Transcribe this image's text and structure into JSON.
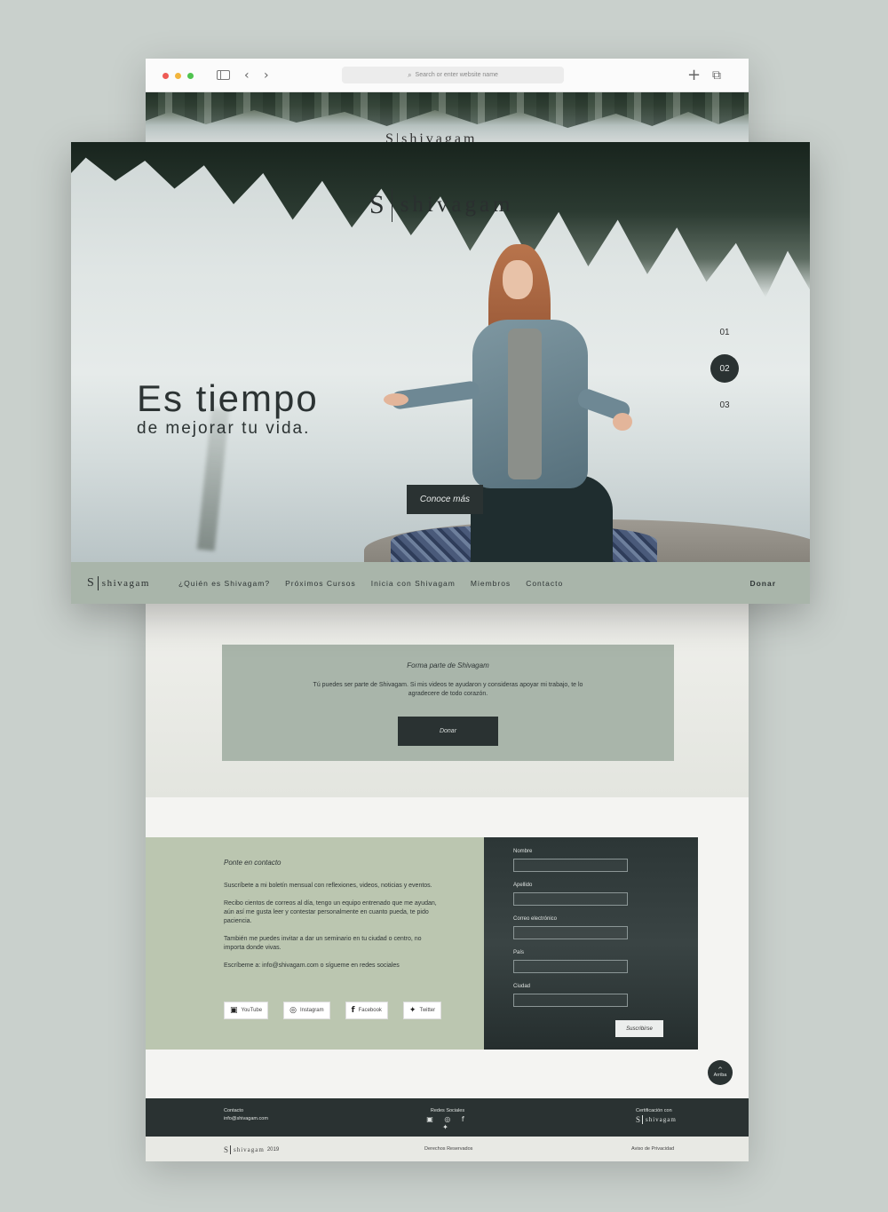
{
  "browser": {
    "url_placeholder": "Search or enter website name",
    "back_icon": "‹",
    "forward_icon": "›",
    "new_tab_icon": "+",
    "tabs_icon": "⧉"
  },
  "brand": {
    "initial": "S",
    "name": "shivagam"
  },
  "hero": {
    "title": "Es tiempo",
    "subtitle": "de mejorar tu vida.",
    "cta": "Conoce más",
    "slides": [
      "01",
      "02",
      "03"
    ],
    "active_slide": 1
  },
  "nav": {
    "items": [
      "¿Quién es Shivagam?",
      "Próximos Cursos",
      "Inicia con Shivagam",
      "Miembros",
      "Contacto"
    ],
    "donate": "Donar"
  },
  "support": {
    "title": "Forma parte de Shivagam",
    "description": "Tú puedes ser parte de Shivagam. Si mis videos te ayudaron y consideras apoyar mi trabajo, te lo agradecere de todo corazón.",
    "button": "Donar"
  },
  "contact": {
    "title": "Ponte en contacto",
    "paragraphs": [
      "Suscríbete a mi boletín mensual con reflexiones, videos, noticias y eventos.",
      "Recibo cientos de correos al día, tengo un equipo entrenado que me ayudan, aún así me gusta leer y contestar personalmente en cuanto pueda, te pido paciencia.",
      "También me puedes invitar a dar un seminario en tu ciudad o centro, no importa donde vivas.",
      "Escríbeme a: info@shivagam.com o sígueme en redes sociales"
    ],
    "socials": [
      {
        "label": "YouTube",
        "icon": "▣"
      },
      {
        "label": "Instagram",
        "icon": "◎"
      },
      {
        "label": "Facebook",
        "icon": "f"
      },
      {
        "label": "Twitter",
        "icon": "✦"
      }
    ],
    "form": {
      "fields": [
        "Nombre",
        "Apellido",
        "Correo electrónico",
        "País",
        "Ciudad"
      ],
      "submit": "Suscribirse"
    }
  },
  "scroll_top": "Arriba",
  "footer": {
    "contact_title": "Contacto",
    "contact_email": "info@shivagam.com",
    "social_title": "Redes Sociales",
    "social_icons": "▣ ◎ f ✦",
    "cert_title": "Certificación con",
    "copyright_year": "2019",
    "rights": "Derechos Reservados",
    "privacy": "Aviso de Privacidad"
  }
}
